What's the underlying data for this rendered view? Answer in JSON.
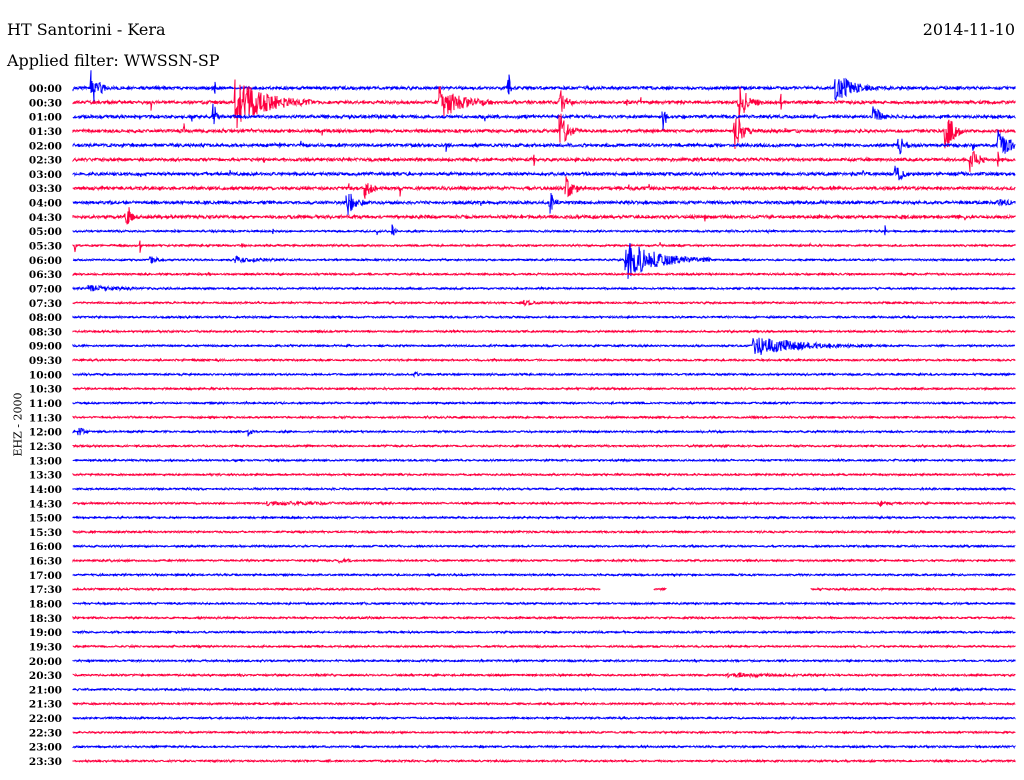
{
  "header": {
    "title": "HT Santorini - Kera",
    "date": "2014-11-10",
    "filter": "Applied filter: WWSSN-SP",
    "channel": "EHZ - 2000"
  },
  "colors": {
    "even": "#0000ff",
    "odd": "#ff0040"
  },
  "chart_data": {
    "type": "line",
    "title": "HT Santorini - Kera",
    "subtitle": "Applied filter: WWSSN-SP",
    "ylabel": "EHZ - 2000",
    "row_minutes": 30,
    "row_labels": [
      "00:00",
      "00:30",
      "01:00",
      "01:30",
      "02:00",
      "02:30",
      "03:00",
      "03:30",
      "04:00",
      "04:30",
      "05:00",
      "05:30",
      "06:00",
      "06:30",
      "07:00",
      "07:30",
      "08:00",
      "08:30",
      "09:00",
      "09:30",
      "10:00",
      "10:30",
      "11:00",
      "11:30",
      "12:00",
      "12:30",
      "13:00",
      "13:30",
      "14:00",
      "14:30",
      "15:00",
      "15:30",
      "16:00",
      "16:30",
      "17:00",
      "17:30",
      "18:00",
      "18:30",
      "19:00",
      "19:30",
      "20:00",
      "20:30",
      "21:00",
      "21:30",
      "22:00",
      "22:30",
      "23:00",
      "23:30"
    ],
    "events": [
      {
        "row": 0,
        "minute": 0.6,
        "amp": 25,
        "dur": 0.3
      },
      {
        "row": 0,
        "minute": 24.3,
        "amp": 15,
        "dur": 0.9
      },
      {
        "row": 0,
        "minute": 13.9,
        "amp": 12,
        "dur": 0.05
      },
      {
        "row": 1,
        "minute": 5.2,
        "amp": 25,
        "dur": 1.6
      },
      {
        "row": 1,
        "minute": 11.7,
        "amp": 15,
        "dur": 1.2
      },
      {
        "row": 1,
        "minute": 15.5,
        "amp": 14,
        "dur": 0.3
      },
      {
        "row": 1,
        "minute": 21.2,
        "amp": 20,
        "dur": 0.5
      },
      {
        "row": 2,
        "minute": 4.5,
        "amp": 12,
        "dur": 0.1
      },
      {
        "row": 2,
        "minute": 18.8,
        "amp": 10,
        "dur": 0.2
      },
      {
        "row": 2,
        "minute": 25.5,
        "amp": 12,
        "dur": 0.3
      },
      {
        "row": 3,
        "minute": 15.5,
        "amp": 20,
        "dur": 0.4
      },
      {
        "row": 3,
        "minute": 21.1,
        "amp": 20,
        "dur": 0.4
      },
      {
        "row": 3,
        "minute": 27.8,
        "amp": 20,
        "dur": 0.4
      },
      {
        "row": 4,
        "minute": 29.5,
        "amp": 15,
        "dur": 0.5
      },
      {
        "row": 4,
        "minute": 26.3,
        "amp": 10,
        "dur": 0.3
      },
      {
        "row": 5,
        "minute": 28.6,
        "amp": 15,
        "dur": 0.3
      },
      {
        "row": 6,
        "minute": 26.2,
        "amp": 10,
        "dur": 0.3
      },
      {
        "row": 7,
        "minute": 9.3,
        "amp": 10,
        "dur": 0.3
      },
      {
        "row": 7,
        "minute": 15.7,
        "amp": 12,
        "dur": 0.4
      },
      {
        "row": 8,
        "minute": 8.7,
        "amp": 15,
        "dur": 0.4
      },
      {
        "row": 8,
        "minute": 15.2,
        "amp": 10,
        "dur": 0.2
      },
      {
        "row": 8,
        "minute": 29.5,
        "amp": 3,
        "dur": 0.6
      },
      {
        "row": 9,
        "minute": 1.7,
        "amp": 8,
        "dur": 0.3
      },
      {
        "row": 10,
        "minute": 10.2,
        "amp": 7,
        "dur": 0.1
      },
      {
        "row": 12,
        "minute": 17.6,
        "amp": 20,
        "dur": 1.8
      },
      {
        "row": 12,
        "minute": 5.2,
        "amp": 3,
        "dur": 1.2
      },
      {
        "row": 12,
        "minute": 2.5,
        "amp": 3,
        "dur": 0.4
      },
      {
        "row": 14,
        "minute": 0.5,
        "amp": 3,
        "dur": 1.3
      },
      {
        "row": 15,
        "minute": 14.4,
        "amp": 2,
        "dur": 0.6
      },
      {
        "row": 18,
        "minute": 21.7,
        "amp": 10,
        "dur": 2.5
      },
      {
        "row": 20,
        "minute": 10.9,
        "amp": 2,
        "dur": 0.2
      },
      {
        "row": 24,
        "minute": 0.2,
        "amp": 6,
        "dur": 0.2
      },
      {
        "row": 24,
        "minute": 5.6,
        "amp": 5,
        "dur": 0.1
      },
      {
        "row": 29,
        "minute": 6.2,
        "amp": 2,
        "dur": 2.6
      },
      {
        "row": 29,
        "minute": 25.7,
        "amp": 2,
        "dur": 0.6
      },
      {
        "row": 33,
        "minute": 8.5,
        "amp": 2,
        "dur": 0.4
      },
      {
        "row": 41,
        "minute": 20.9,
        "amp": 2,
        "dur": 1.9
      }
    ],
    "gaps": [
      {
        "row": 35,
        "from": 16.8,
        "to": 23.5
      }
    ]
  }
}
